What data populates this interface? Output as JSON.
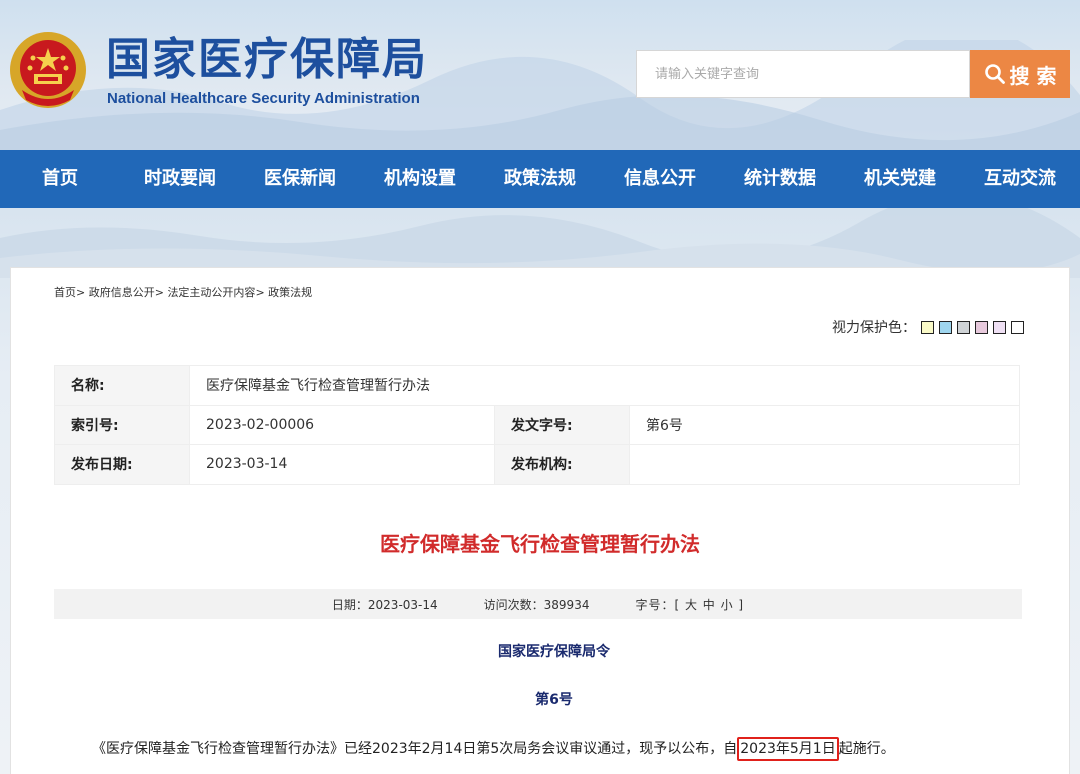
{
  "header": {
    "title": "国家医疗保障局",
    "subtitle": "National Healthcare Security Administration",
    "search_placeholder": "请输入关键字查询",
    "search_label": "搜 索"
  },
  "nav": {
    "items": [
      "首页",
      "时政要闻",
      "医保新闻",
      "机构设置",
      "政策法规",
      "信息公开",
      "统计数据",
      "机关党建",
      "互动交流"
    ]
  },
  "breadcrumb": {
    "items": [
      "首页",
      "政府信息公开",
      "法定主动公开内容",
      "政策法规"
    ],
    "separator": ">"
  },
  "eye_care": {
    "label": "视力保护色：",
    "colors": [
      "#fafac8",
      "#9fd6ef",
      "#cfd3d6",
      "#e7c9dc",
      "#efe0f4",
      "#ffffff"
    ]
  },
  "meta": {
    "name_label": "名称:",
    "name_value": "医疗保障基金飞行检查管理暂行办法",
    "index_label": "索引号:",
    "index_value": "2023-02-00006",
    "docno_label": "发文字号:",
    "docno_value": "第6号",
    "date_label": "发布日期:",
    "date_value": "2023-03-14",
    "org_label": "发布机构:",
    "org_value": ""
  },
  "article": {
    "title": "医疗保障基金飞行检查管理暂行办法",
    "info_date": "日期：2023-03-14",
    "info_visits": "访问次数：389934",
    "info_fontsize": "字号：[ 大 中 小 ]",
    "order_head": "国家医疗保障局令",
    "order_no": "第6号",
    "body_before": "《医疗保障基金飞行检查管理暂行办法》已经2023年2月14日第5次局务会议审议通过，现予以公布，自",
    "body_highlight": "2023年5月1日",
    "body_after": "起施行。"
  },
  "colors": {
    "brand_blue": "#1d4f9e",
    "nav_blue": "#2168b8",
    "search_orange": "#ec8744",
    "title_red": "#d12b2b",
    "highlight_red": "#e0211b"
  }
}
